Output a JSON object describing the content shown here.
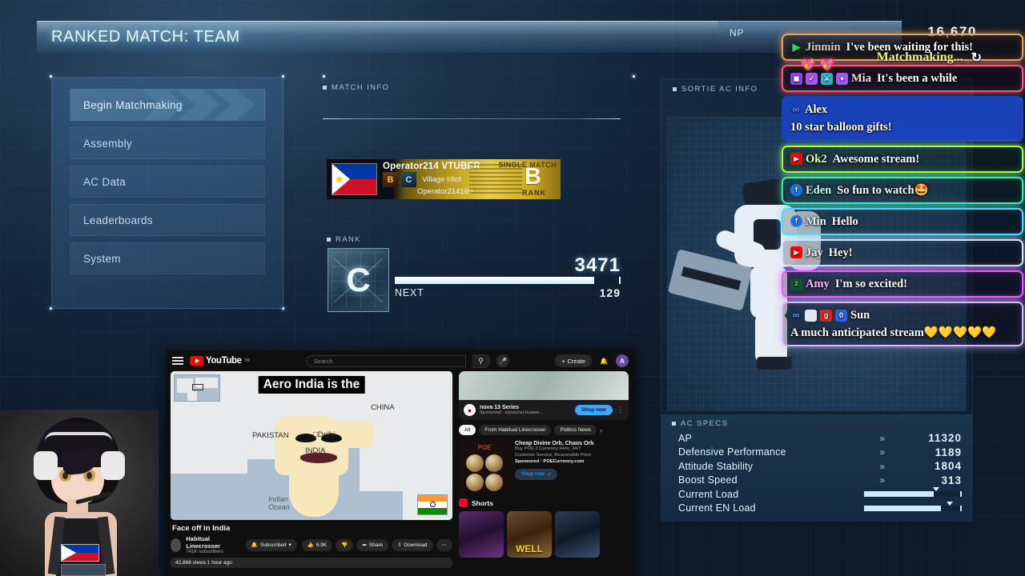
{
  "header": {
    "title": "RANKED MATCH: TEAM"
  },
  "menu": {
    "items": [
      {
        "label": "Begin Matchmaking",
        "active": true
      },
      {
        "label": "Assembly",
        "active": false
      },
      {
        "label": "AC Data",
        "active": false
      },
      {
        "label": "Leaderboards",
        "active": false
      },
      {
        "label": "System",
        "active": false
      }
    ]
  },
  "match_info": {
    "section_label": "MATCH INFO",
    "operator_card": {
      "name": "Operator214 VTUBER",
      "subtitle": "Village Idiot",
      "operator_id": "Operator214160",
      "badge_left": "B",
      "badge_right": "C",
      "match_type": "SINGLE MATCH",
      "rank_letter": "B",
      "rank_label": "RANK",
      "flag": "philippines-flag"
    }
  },
  "rank": {
    "section_label": "RANK",
    "letter": "C",
    "points": "3471",
    "next_label": "NEXT",
    "next_value": "129",
    "progress_percent": 89
  },
  "np": {
    "label": "NP",
    "value": "16,670"
  },
  "sortie": {
    "section_label": "SORTIE AC INFO"
  },
  "ac_specs": {
    "section_label": "AC SPECS",
    "rows": [
      {
        "name": "AP",
        "value": "11320",
        "type": "value"
      },
      {
        "name": "Defensive Performance",
        "value": "1189",
        "type": "value"
      },
      {
        "name": "Attitude Stability",
        "value": "1804",
        "type": "value"
      },
      {
        "name": "Boost Speed",
        "value": "313",
        "type": "value"
      },
      {
        "name": "Current Load",
        "value": "",
        "type": "gauge",
        "fill": 72,
        "marker": 74
      },
      {
        "name": "Current EN Load",
        "value": "",
        "type": "gauge",
        "fill": 80,
        "marker": 88
      }
    ]
  },
  "status": {
    "matchmaking": "Matchmaking...",
    "spinner": "↻",
    "hearts": [
      "💖",
      "💖"
    ]
  },
  "chat": {
    "messages": [
      {
        "id": "m0",
        "badges": [
          "play-icon"
        ],
        "user": "Jinmin",
        "text": "I've been waiting for this!"
      },
      {
        "id": "m1",
        "badges": [
          "twitch-icon",
          "verified-icon",
          "moderator-icon",
          "subscriber-icon"
        ],
        "user": "Mia",
        "text": "It's been a while"
      },
      {
        "id": "m2",
        "badges": [
          "infinity-icon"
        ],
        "user": "Alex",
        "text": "10 star balloon gifts!"
      },
      {
        "id": "m3",
        "badges": [
          "youtube-icon"
        ],
        "user": "Ok2",
        "text": "Awesome stream!"
      },
      {
        "id": "m4",
        "badges": [
          "facebook-icon"
        ],
        "user": "Eden",
        "text": "So fun to watch🤩"
      },
      {
        "id": "m5",
        "badges": [
          "facebook-icon"
        ],
        "user": "Min",
        "text": "Hello"
      },
      {
        "id": "m6",
        "badges": [
          "youtube-icon"
        ],
        "user": "Jay",
        "text": "Hey!"
      },
      {
        "id": "m7",
        "badges": [
          "zeta-icon"
        ],
        "user": "Amy",
        "text": "I'm so excited!"
      },
      {
        "id": "m8",
        "badges": [
          "infinity-icon",
          "white-badge-icon",
          "red-badge-icon",
          "blue-badge-icon"
        ],
        "user": "Sun",
        "text": "A much anticipated stream💛💛💛💛💛"
      }
    ]
  },
  "youtube": {
    "logo_text": "YouTube",
    "logo_tm": "TM",
    "search_placeholder": "Search",
    "create_label": "Create",
    "avatar_initial": "A",
    "video": {
      "overlay_title": "Aero India is the",
      "title": "Face off in India",
      "channel": "Habitual Linecrosser",
      "subscribers": "741K subscribers",
      "subscribe_label": "Subscribed",
      "likes": "6.9K",
      "share_label": "Share",
      "download_label": "Download",
      "views_line": "42,868 views  1 hour ago"
    },
    "map": {
      "labels": [
        "CHINA",
        "PAKISTAN",
        "Delhi",
        "INDIA"
      ],
      "ocean_label": "Indian Ocean"
    },
    "sidebar": {
      "ad1": {
        "title": "nova 13 Series",
        "sponsor": "Sponsored  ·  consumer.huawei...",
        "cta": "Shop now"
      },
      "chips": [
        "All",
        "From Habitual Linecrosser",
        "Politics News"
      ],
      "ad2": {
        "title": "Cheap Divine Orb, Chaos Orb",
        "line1": "Buy POE 2 Currency Here, 24/7",
        "line2": "Customer Service, Reasonable Price",
        "sponsor": "Sponsored  ·  POECurrency.com",
        "cta": "Shop now",
        "thumb_text": "POE"
      },
      "shorts_label": "Shorts",
      "shorts": [
        {
          "caption": ""
        },
        {
          "caption": "WELL"
        },
        {
          "caption": ""
        }
      ]
    }
  }
}
